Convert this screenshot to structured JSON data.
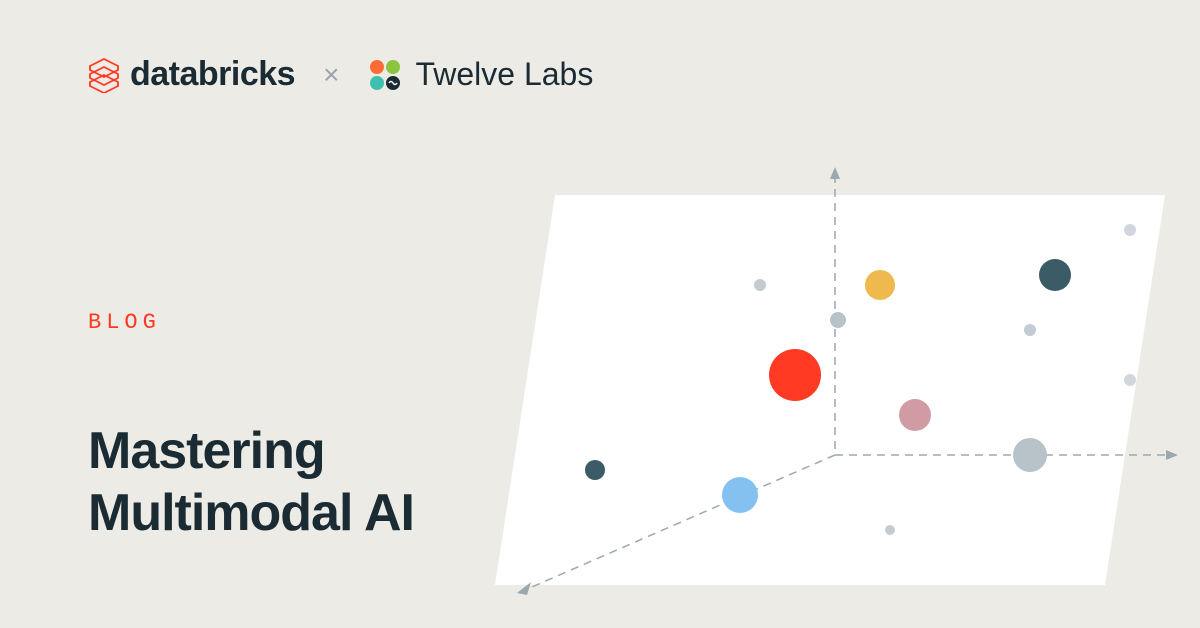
{
  "header": {
    "brand1": "databricks",
    "separator": "×",
    "brand2": "Twelve Labs"
  },
  "label": "BLOG",
  "title_line1": "Mastering",
  "title_line2": "Multimodal AI",
  "colors": {
    "accent": "#ff3922",
    "text": "#1b2b33",
    "bg": "#ecebe6"
  }
}
